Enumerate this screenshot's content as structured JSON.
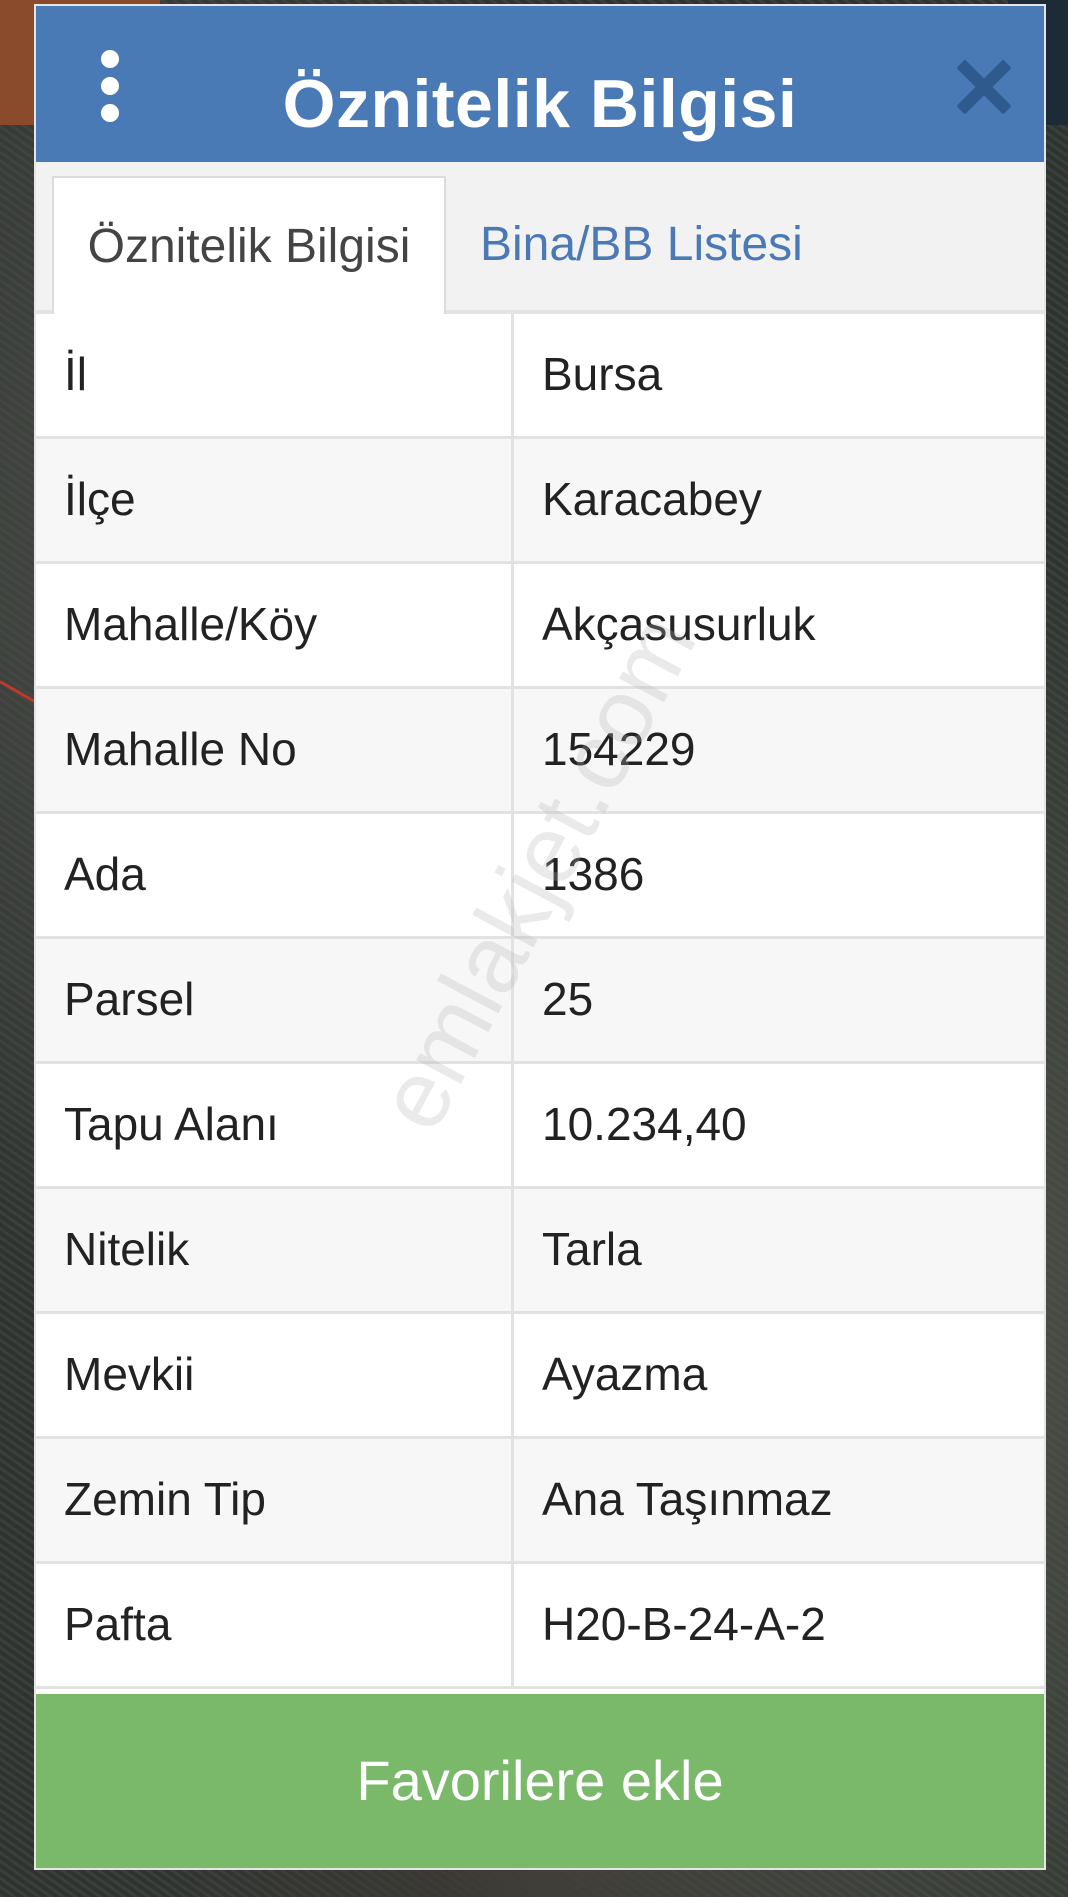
{
  "header": {
    "title": "Öznitelik Bilgisi"
  },
  "tabs": [
    {
      "label": "Öznitelik Bilgisi",
      "active": true
    },
    {
      "label": "Bina/BB Listesi",
      "active": false
    }
  ],
  "attributes": [
    {
      "key": "İl",
      "value": "Bursa"
    },
    {
      "key": "İlçe",
      "value": "Karacabey"
    },
    {
      "key": "Mahalle/Köy",
      "value": "Akçasusurluk"
    },
    {
      "key": "Mahalle No",
      "value": "154229"
    },
    {
      "key": "Ada",
      "value": "1386"
    },
    {
      "key": "Parsel",
      "value": "25"
    },
    {
      "key": "Tapu Alanı",
      "value": "10.234,40"
    },
    {
      "key": "Nitelik",
      "value": "Tarla"
    },
    {
      "key": "Mevkii",
      "value": "Ayazma"
    },
    {
      "key": "Zemin Tip",
      "value": "Ana Taşınmaz"
    },
    {
      "key": "Pafta",
      "value": "H20-B-24-A-2"
    }
  ],
  "watermark": "emlakjet.com",
  "footer": {
    "button_label": "Favorilere ekle"
  },
  "colors": {
    "header_bg": "#4a7ab5",
    "close_icon": "#2f5a8e",
    "tab_link": "#4a7ab5",
    "button_bg": "#7ab86a"
  }
}
